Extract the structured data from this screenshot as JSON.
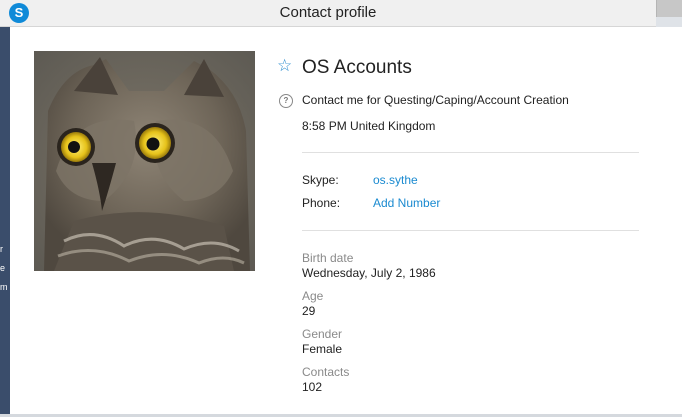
{
  "window": {
    "title": "Contact profile",
    "logo": "skype-icon"
  },
  "profile": {
    "name": "OS Accounts",
    "mood": "Contact me for Questing/Caping/Account Creation",
    "local_time": "8:58 PM United Kingdom",
    "avatar": "owl-photo"
  },
  "contact": {
    "skype_label": "Skype:",
    "skype_value": "os.sythe",
    "phone_label": "Phone:",
    "phone_value": "Add Number"
  },
  "details": [
    {
      "label": "Birth date",
      "value": "Wednesday, July 2, 1986"
    },
    {
      "label": "Age",
      "value": "29"
    },
    {
      "label": "Gender",
      "value": "Female"
    },
    {
      "label": "Contacts",
      "value": "102"
    }
  ],
  "colors": {
    "accent": "#1a8ad0",
    "background": "#ffffff",
    "titlebar": "#f0f0f0"
  },
  "left_strip_chars": [
    "r",
    "e",
    "m"
  ]
}
